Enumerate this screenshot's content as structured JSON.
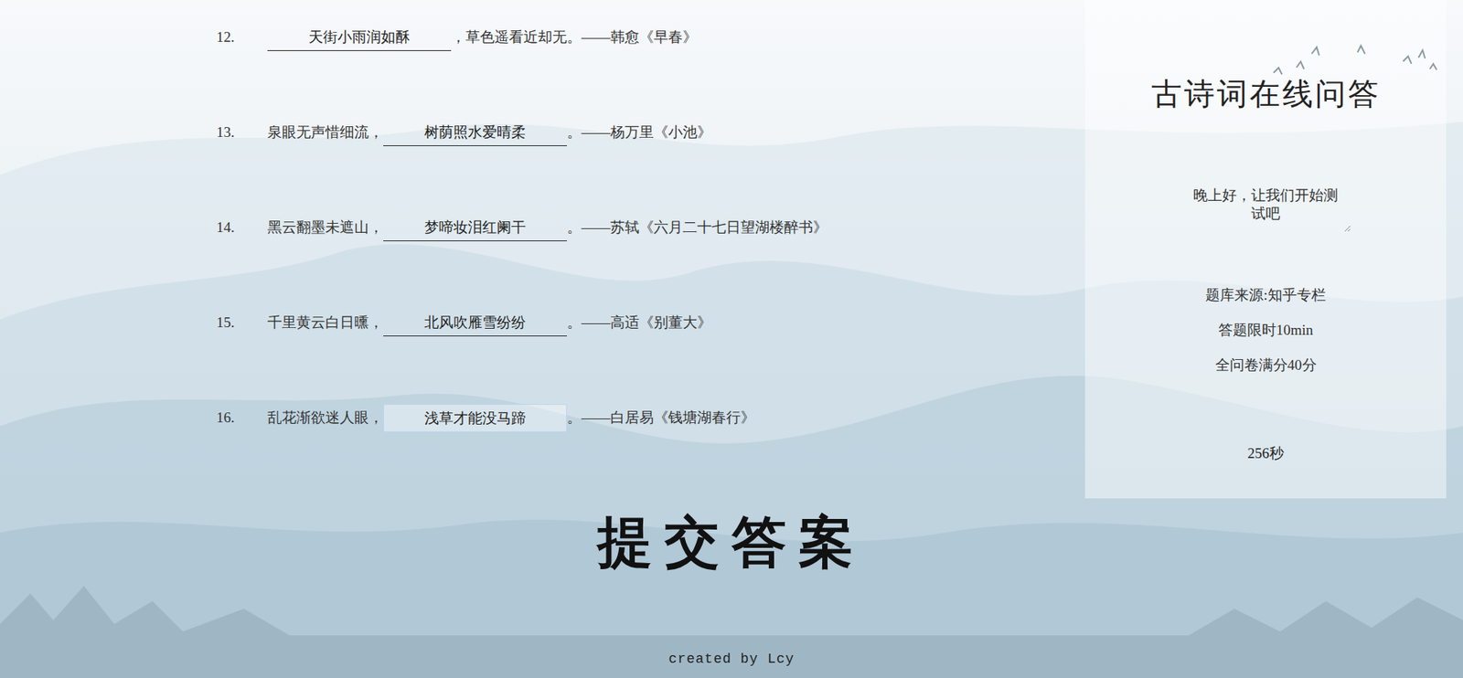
{
  "questions": [
    {
      "number": "12.",
      "before": "",
      "answer": "天街小雨润如酥",
      "after": "，草色遥看近却无。——韩愈《早春》",
      "focused": false
    },
    {
      "number": "13.",
      "before": "泉眼无声惜细流，",
      "answer": "树荫照水爱晴柔",
      "after": "。——杨万里《小池》",
      "focused": false
    },
    {
      "number": "14.",
      "before": "黑云翻墨未遮山，",
      "answer": "梦啼妆泪红阑干",
      "after": "。——苏轼《六月二十七日望湖楼醉书》",
      "focused": false
    },
    {
      "number": "15.",
      "before": "千里黄云白日曛，",
      "answer": "北风吹雁雪纷纷",
      "after": "。——高适《别董大》",
      "focused": false
    },
    {
      "number": "16.",
      "before": "乱花渐欲迷人眼，",
      "answer": "浅草才能没马蹄",
      "after": "。——白居易《钱塘湖春行》",
      "focused": true
    }
  ],
  "panel": {
    "title": "古诗词在线问答",
    "greeting": "晚上好，让我们开始测试吧",
    "info": [
      "题库来源:知乎专栏",
      "答题限时10min",
      "全问卷满分40分"
    ],
    "timer": "256秒"
  },
  "submit": "提交答案",
  "footer": "created by Lcy"
}
